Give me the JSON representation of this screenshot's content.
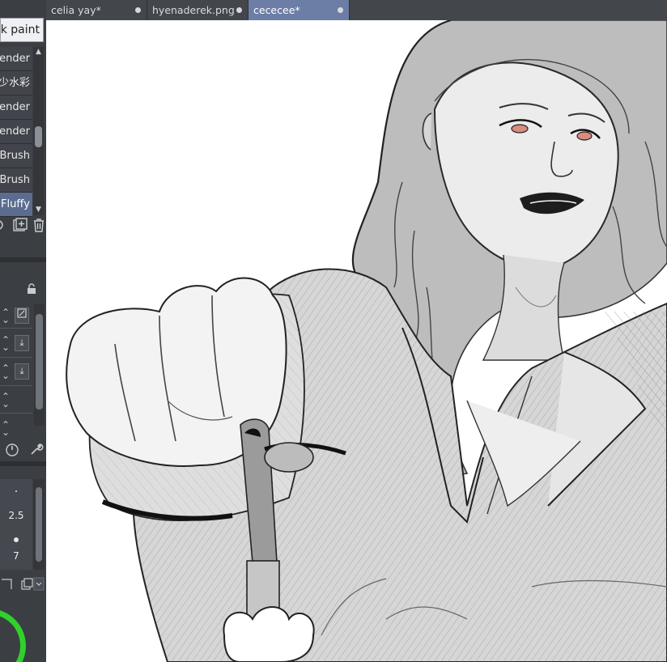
{
  "tabs": [
    {
      "label": "celia yay*",
      "active": false
    },
    {
      "label": "hyenaderek.png",
      "active": false
    },
    {
      "label": "cececee*",
      "active": true
    }
  ],
  "brushes": {
    "current": "Thick paint",
    "items": [
      {
        "label": "Render",
        "selected": false
      },
      {
        "label": "少水彩",
        "selected": false
      },
      {
        "label": "Render",
        "selected": false
      },
      {
        "label": "Render",
        "selected": false
      },
      {
        "label": "Brush",
        "selected": false
      },
      {
        "label": "Brush!!",
        "selected": false
      },
      {
        "label": "Fluffy",
        "selected": true
      }
    ]
  },
  "brush_size": {
    "values": [
      "2.5",
      "7"
    ]
  },
  "colors": {
    "accent": "#6c7ea6",
    "selected_item": "#5b6c8f",
    "panel": "#3b3e43",
    "wheel_green": "#2fd12a",
    "canvas": "#ffffff"
  },
  "icons": [
    "new-folder-icon",
    "add-brush-icon",
    "trash-icon",
    "lock-icon",
    "pressure-icon",
    "settings-wrench-icon",
    "layer-icon"
  ]
}
